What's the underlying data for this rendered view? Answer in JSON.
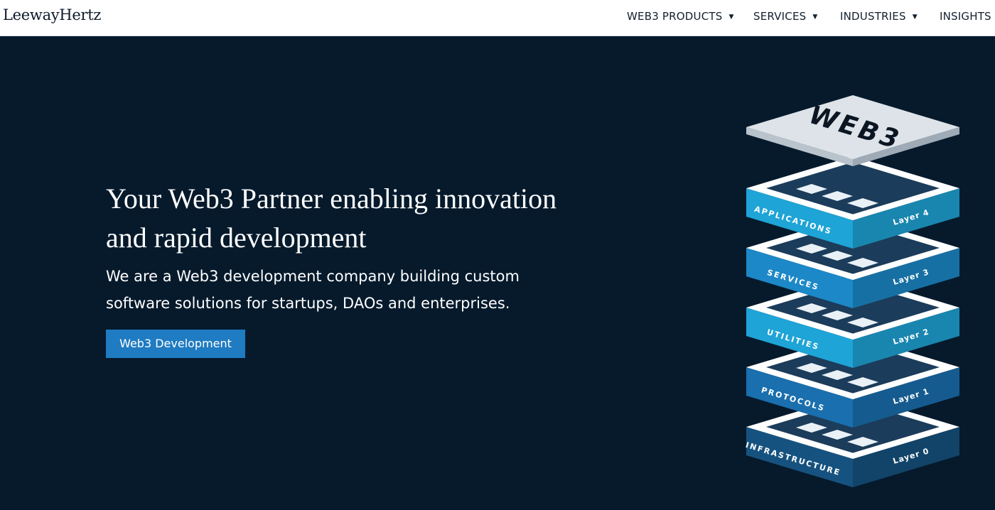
{
  "header": {
    "logo": "LeewayHertz",
    "nav": [
      {
        "label": "WEB3 PRODUCTS",
        "caret": "▼"
      },
      {
        "label": "SERVICES",
        "caret": "▼"
      },
      {
        "label": "INDUSTRIES",
        "caret": "▼"
      },
      {
        "label": "INSIGHTS"
      }
    ]
  },
  "hero": {
    "title": "Your Web3 Partner enabling innovation and rapid development",
    "subtitle": "We are a Web3 development company building custom software solutions for startups, DAOs and enterprises.",
    "cta_label": "Web3 Development"
  },
  "illustration": {
    "top_label": "WEB3",
    "layers": [
      {
        "name": "APPLICATIONS",
        "layer": "Layer 4",
        "color": "#1ea4d6"
      },
      {
        "name": "SERVICES",
        "layer": "Layer 3",
        "color": "#1c88c7"
      },
      {
        "name": "UTILITIES",
        "layer": "Layer 2",
        "color": "#1ea4d6"
      },
      {
        "name": "PROTOCOLS",
        "layer": "Layer 1",
        "color": "#1a6fae"
      },
      {
        "name": "INFRASTRUCTURE",
        "layer": "Layer 0",
        "color": "#16527f"
      }
    ]
  },
  "colors": {
    "hero_background": "#061a2c",
    "accent_button": "#1f7bc2",
    "navbar_background": "#ffffff"
  }
}
